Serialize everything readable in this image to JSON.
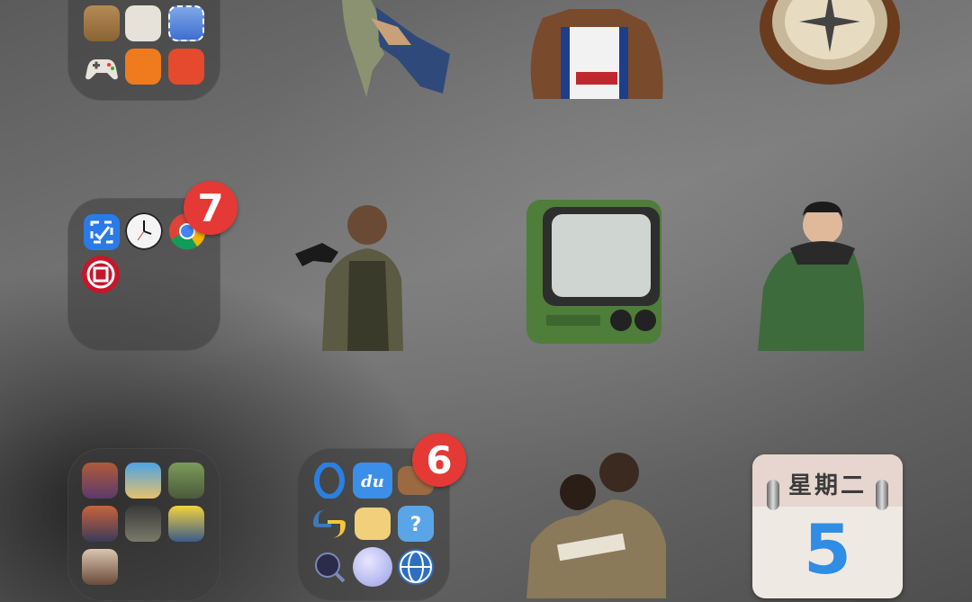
{
  "badges": {
    "folder2": "7",
    "folder5": "6"
  },
  "calendar": {
    "weekday": "星期二",
    "day": "5"
  },
  "icons": {
    "folder1": [
      "book-app-icon",
      "pad-app-icon",
      "stamp-app-icon",
      "gamepad-app-icon",
      "orange-app-icon",
      "red-app-icon"
    ],
    "folder2": [
      "capture-app-icon",
      "clock-app-icon",
      "chrome-app-icon",
      "bank-app-icon"
    ],
    "folder4": [
      "game1-icon",
      "game2-icon",
      "game3-icon",
      "game4-icon",
      "game5-icon",
      "game6-icon",
      "game7-icon"
    ],
    "folder5": [
      "browser-app-icon",
      "baidu-app-icon",
      "wallet-app-icon",
      "python-app-icon",
      "notes-app-icon",
      "help-app-icon",
      "search-grid-app-icon",
      "orb-app-icon",
      "globe-app-icon"
    ]
  },
  "colors": {
    "badge": "#e53935",
    "calendar_day": "#2f8de4"
  }
}
